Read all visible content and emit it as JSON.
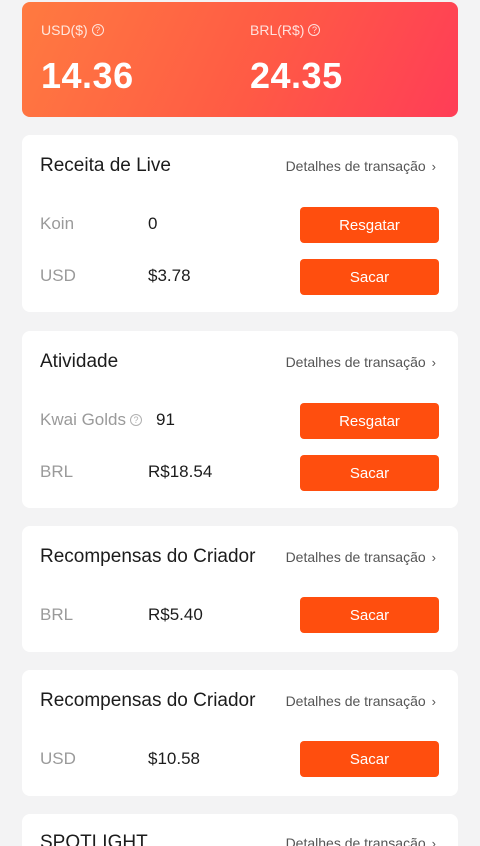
{
  "balances": {
    "usd": {
      "label": "USD($)",
      "amount": "14.36"
    },
    "brl": {
      "label": "BRL(R$)",
      "amount": "24.35"
    }
  },
  "cards": [
    {
      "title": "Receita de Live",
      "details": "Detalhes de transação",
      "rows": [
        {
          "label": "Koin",
          "value": "0",
          "button": "Resgatar"
        },
        {
          "label": "USD",
          "value": "$3.78",
          "button": "Sacar"
        }
      ]
    },
    {
      "title": "Atividade",
      "details": "Detalhes de transação",
      "rows": [
        {
          "label": "Kwai Golds",
          "value": "91",
          "button": "Resgatar"
        },
        {
          "label": "BRL",
          "value": "R$18.54",
          "button": "Sacar"
        }
      ]
    },
    {
      "title": "Recompensas do Criador",
      "details": "Detalhes de transação",
      "rows": [
        {
          "label": "BRL",
          "value": "R$5.40",
          "button": "Sacar"
        }
      ]
    },
    {
      "title": "Recompensas do Criador",
      "details": "Detalhes de transação",
      "rows": [
        {
          "label": "USD",
          "value": "$10.58",
          "button": "Sacar"
        }
      ]
    },
    {
      "title": "SPOTLIGHT",
      "details": "Detalhes de transação",
      "rows": []
    }
  ],
  "icons": {
    "help": "question-circle-icon",
    "chevron": "chevron-right-icon"
  },
  "colors": {
    "banner_start": "#ff7a40",
    "banner_end": "#ff3d57",
    "button": "#ff4e0e",
    "background": "#f3f3f4"
  }
}
